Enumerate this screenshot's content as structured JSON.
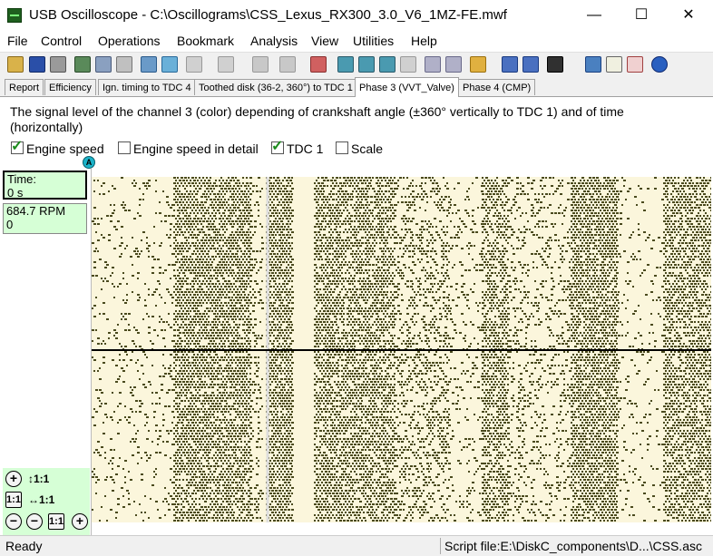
{
  "window": {
    "title": "USB Oscilloscope - C:\\Oscillograms\\CSS_Lexus_RX300_3.0_V6_1MZ-FE.mwf",
    "minimize": "—",
    "maximize": "☐",
    "close": "✕"
  },
  "menu": [
    "File",
    "Control",
    "Operations",
    "Bookmark",
    "Analysis",
    "View",
    "Utilities",
    "Help"
  ],
  "tabs": [
    {
      "label": "Report",
      "active": false
    },
    {
      "label": "Efficiency",
      "active": false
    },
    {
      "label": "Ign. timing to TDC 4",
      "active": false
    },
    {
      "label": "Toothed disk (36-2, 360°) to TDC 1",
      "active": false
    },
    {
      "label": "Phase 3 (VVT_Valve)",
      "active": true
    },
    {
      "label": "Phase 4 (CMP)",
      "active": false
    }
  ],
  "description": "The signal level of the channel 3 (color) depending of crankshaft angle (±360° vertically to TDC 1) and of time (horizontally)",
  "options": [
    {
      "label": "Engine speed",
      "checked": true
    },
    {
      "label": "Engine speed in detail",
      "checked": false
    },
    {
      "label": "TDC 1",
      "checked": true
    },
    {
      "label": "Scale",
      "checked": false
    }
  ],
  "marker": "A",
  "readouts": {
    "time_label": "Time:",
    "time_value": "0 s",
    "rpm_value": "684.7 RPM",
    "rpm_sub": "0"
  },
  "zoom": {
    "vertical": "↕1:1",
    "horizontal": "↔1:1",
    "plus": "+",
    "minus": "−",
    "one_to_one": "1:1"
  },
  "status": {
    "left": "Ready",
    "right": "Script file:E:\\DiskC_components\\D...\\CSS.asc"
  },
  "colors": {
    "plot_background": "#fbf6dc",
    "plot_dark": "#4a4a1e",
    "readout_background": "#d6ffd6",
    "marker": "#1bb3c9"
  }
}
